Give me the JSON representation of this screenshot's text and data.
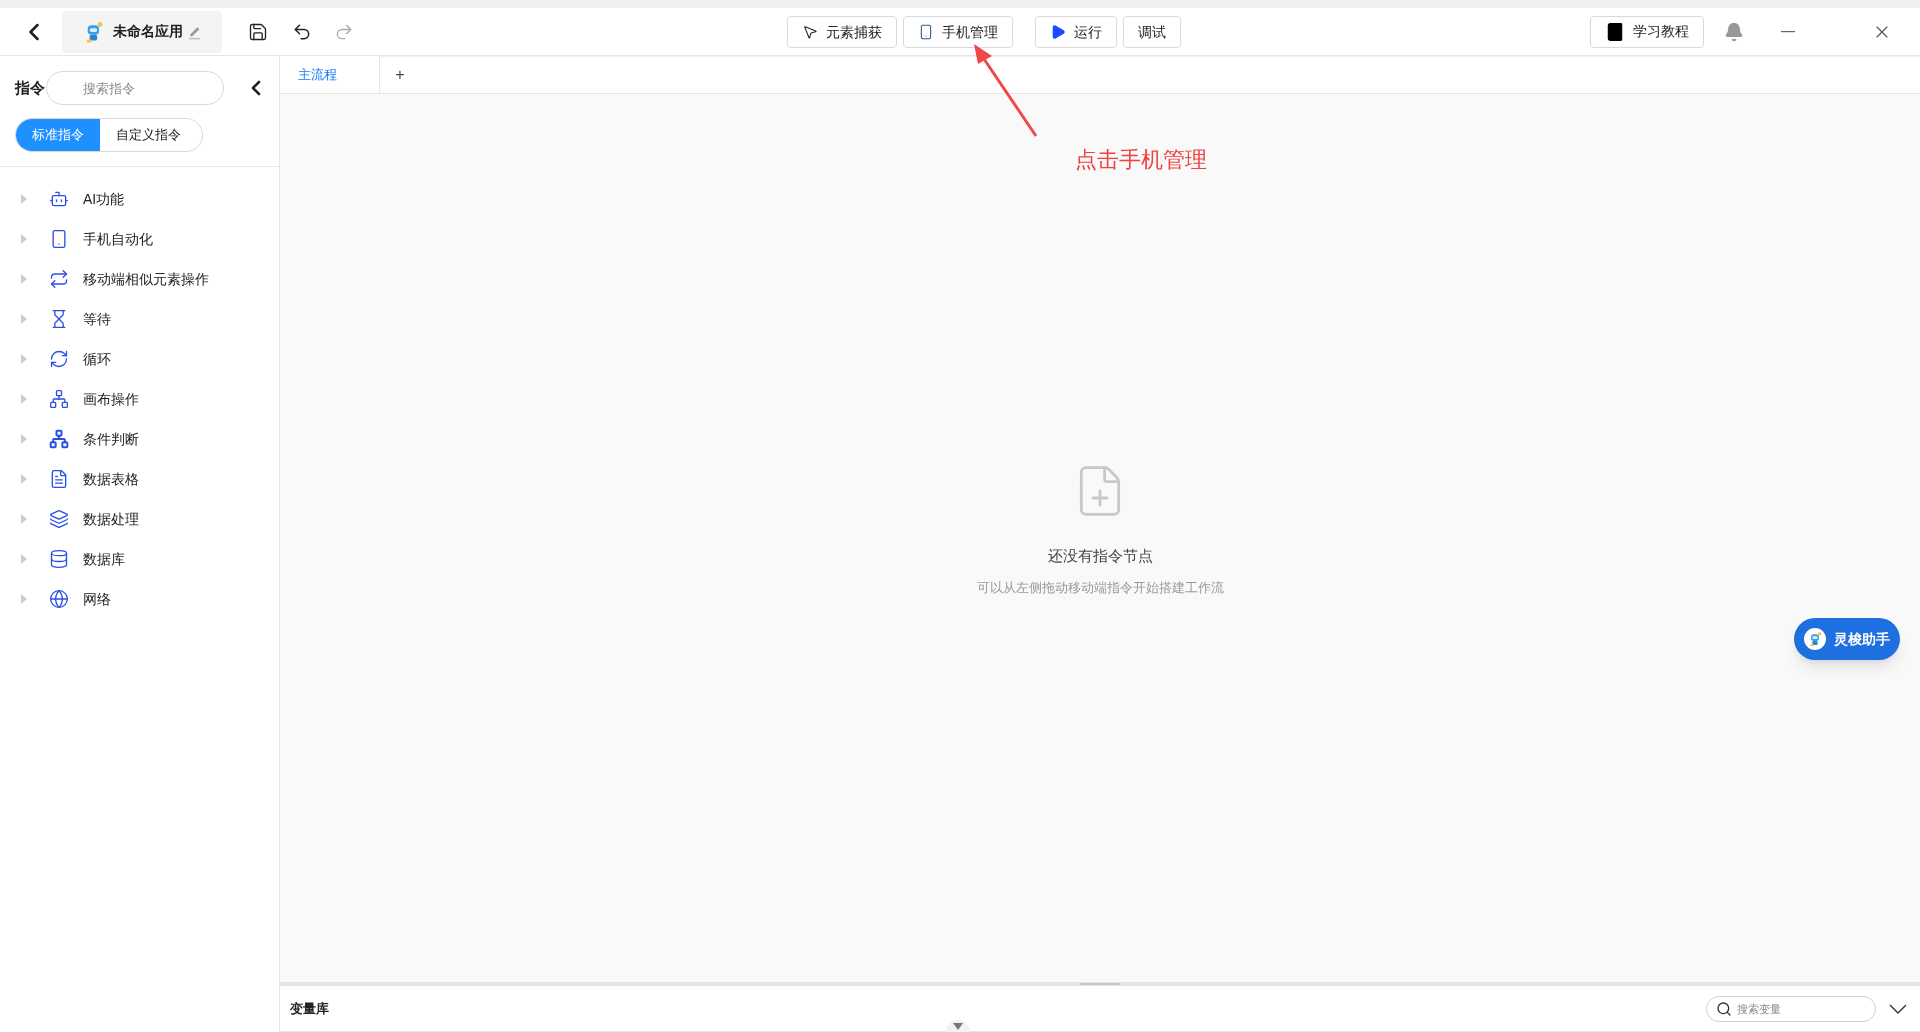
{
  "app": {
    "name": "未命名应用"
  },
  "toolbar": [
    {
      "kind": "capture",
      "label": "元素捕获"
    },
    {
      "kind": "phone",
      "label": "手机管理"
    },
    {
      "kind": "run",
      "label": "运行"
    },
    {
      "kind": "plain",
      "label": "调试"
    }
  ],
  "tutorial": {
    "label": "学习教程"
  },
  "sidebar": {
    "title": "指令",
    "search": {
      "placeholder": "搜索指令"
    },
    "segments": [
      {
        "label": "标准指令",
        "selected": true
      },
      {
        "label": "自定义指令",
        "selected": false
      }
    ],
    "items": [
      {
        "kind": "ai",
        "label": "AI功能",
        "expanded": false
      },
      {
        "kind": "phone",
        "label": "手机自动化",
        "expanded": false
      },
      {
        "kind": "similar",
        "label": "移动端相似元素操作",
        "expanded": false
      },
      {
        "kind": "wait",
        "label": "等待",
        "expanded": false
      },
      {
        "kind": "loop",
        "label": "循环",
        "expanded": false
      },
      {
        "kind": "canvas",
        "label": "画布操作",
        "expanded": false
      },
      {
        "kind": "condition",
        "label": "条件判断",
        "expanded": false
      },
      {
        "kind": "table",
        "label": "数据表格",
        "expanded": false
      },
      {
        "kind": "data",
        "label": "数据处理",
        "expanded": false
      },
      {
        "kind": "db",
        "label": "数据库",
        "expanded": false
      },
      {
        "kind": "net",
        "label": "网络",
        "expanded": false
      }
    ]
  },
  "tabs": [
    {
      "label": "主流程",
      "selected": true
    }
  ],
  "add_tab": "+",
  "annotation": {
    "text": "点击手机管理"
  },
  "empty_state": {
    "title": "还没有指令节点",
    "hint": "可以从左侧拖动移动端指令开始搭建工作流"
  },
  "assistant": {
    "label": "灵梭助手"
  },
  "variables": {
    "title": "变量库",
    "search": {
      "placeholder": "搜索变量"
    }
  }
}
